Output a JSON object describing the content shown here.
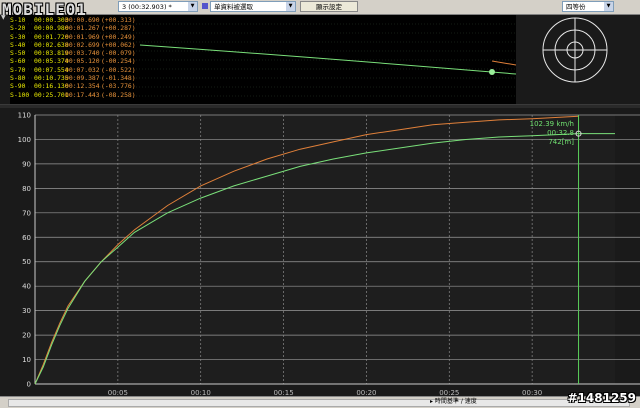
{
  "logo": {
    "text": "MOBILE01"
  },
  "toolbar": {
    "session_select": "3    (00:32.903)  *",
    "data_select": "单資料被選取",
    "display_settings": "顯示設定",
    "split_select": "四等份"
  },
  "splits": [
    {
      "label": "S-10",
      "time": "00:00.303",
      "cmp": "00:00.690",
      "diff": "(+00.313)"
    },
    {
      "label": "S-20",
      "time": "00:00.980",
      "cmp": "00:01.267",
      "diff": "(+00.287)"
    },
    {
      "label": "S-30",
      "time": "00:01.720",
      "cmp": "00:01.969",
      "diff": "(+00.249)"
    },
    {
      "label": "S-40",
      "time": "00:02.638",
      "cmp": "00:02.699",
      "diff": "(+00.062)"
    },
    {
      "label": "S-50",
      "time": "00:03.819",
      "cmp": "00:03.740",
      "diff": "(-00.079)"
    },
    {
      "label": "S-60",
      "time": "00:05.374",
      "cmp": "00:05.120",
      "diff": "(-00.254)"
    },
    {
      "label": "S-70",
      "time": "00:07.554",
      "cmp": "00:07.032",
      "diff": "(-00.522)"
    },
    {
      "label": "S-80",
      "time": "00:10.735",
      "cmp": "00:09.387",
      "diff": "(-01.348)"
    },
    {
      "label": "S-90",
      "time": "00:16.130",
      "cmp": "00:12.354",
      "diff": "(-03.776)"
    },
    {
      "label": "S-100",
      "time": "00:25.701",
      "cmp": "00:17.443",
      "diff": "(-08.258)"
    }
  ],
  "readout": {
    "speed": "102.39 km/h",
    "time": "00:32.8",
    "distance": "742[m]"
  },
  "status": {
    "axis_mode": "時間基準 / 速度"
  },
  "watermark": "#1481259",
  "colors": {
    "green": "#7ae07a",
    "orange": "#e0803a",
    "grid": "#9a9a9a",
    "cursor": "#5ad05a"
  },
  "chart_data": {
    "type": "line",
    "x_unit": "s",
    "xlim": [
      0,
      35
    ],
    "ylim": [
      0,
      110
    ],
    "x_ticks": [
      "00:05",
      "00:10",
      "00:15",
      "00:20",
      "00:25",
      "00:30"
    ],
    "y_ticks": [
      0,
      10,
      20,
      30,
      40,
      50,
      60,
      70,
      80,
      90,
      100,
      110
    ],
    "grid": true,
    "cursor_x": 32.8,
    "series": [
      {
        "color": "#e0803a",
        "x": [
          0,
          0.5,
          1,
          1.5,
          2,
          3,
          4,
          5,
          6,
          8,
          10,
          12,
          14,
          16,
          18,
          20,
          22,
          24,
          26,
          28,
          30,
          32.8
        ],
        "y": [
          0,
          8,
          17,
          25,
          32,
          42,
          50,
          57,
          63,
          73,
          81,
          87,
          92,
          96,
          99,
          102,
          104,
          106,
          107,
          108,
          108.5,
          109.5
        ]
      },
      {
        "color": "#7ae07a",
        "x": [
          0,
          0.5,
          1,
          1.5,
          2,
          3,
          4,
          5,
          6,
          8,
          10,
          12,
          14,
          16,
          18,
          20,
          22,
          24,
          26,
          28,
          30,
          32.8,
          35
        ],
        "y": [
          0,
          7,
          16,
          24,
          31,
          42,
          50,
          56,
          62,
          70,
          76,
          81,
          85,
          89,
          92,
          94.5,
          96.5,
          98.5,
          100,
          101,
          101.5,
          102.4,
          102.4
        ]
      }
    ]
  }
}
